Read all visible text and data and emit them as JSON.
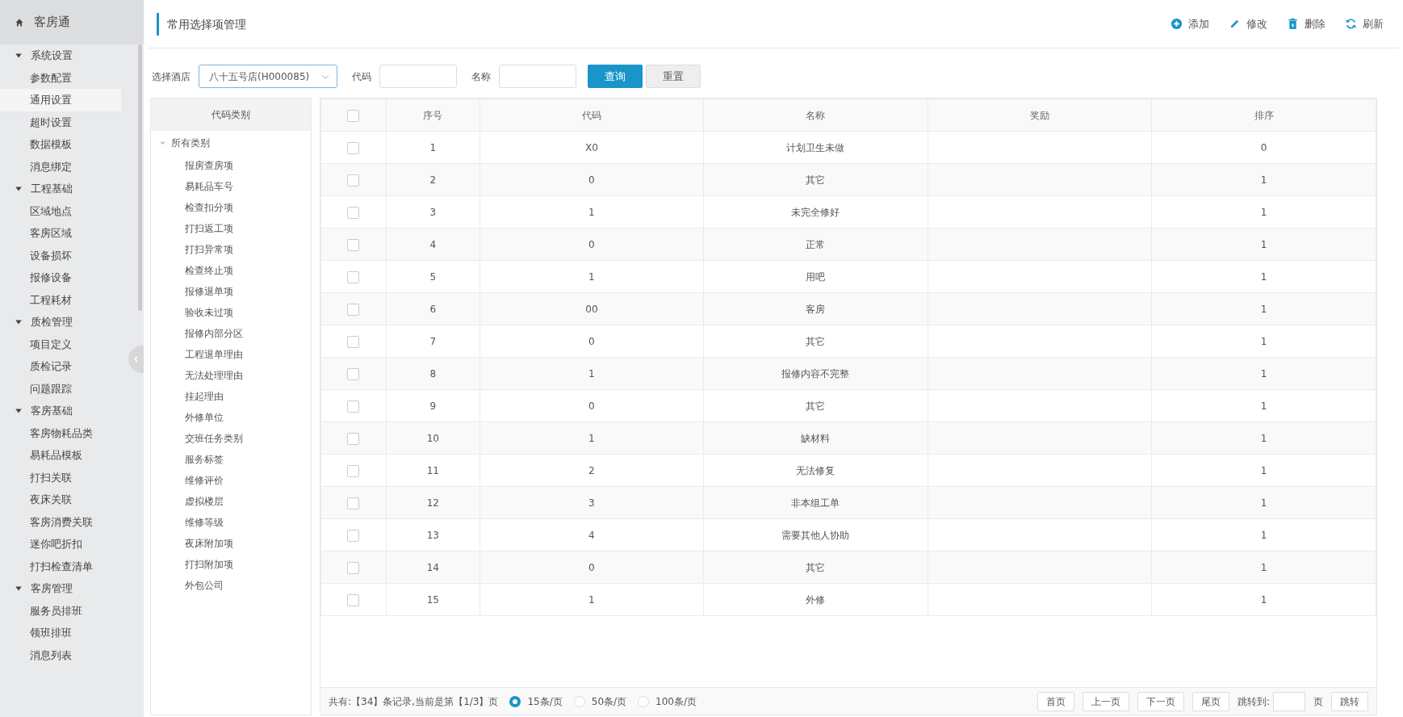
{
  "app": {
    "title": "客房通"
  },
  "sidebar": {
    "groups": [
      {
        "label": "系统设置",
        "expanded": true,
        "items": [
          {
            "label": "参数配置",
            "selected": false
          },
          {
            "label": "通用设置",
            "selected": true
          },
          {
            "label": "超时设置",
            "selected": false
          },
          {
            "label": "数据模板",
            "selected": false
          },
          {
            "label": "消息绑定",
            "selected": false
          }
        ]
      },
      {
        "label": "工程基础",
        "expanded": true,
        "items": [
          {
            "label": "区域地点",
            "selected": false
          },
          {
            "label": "客房区域",
            "selected": false
          },
          {
            "label": "设备损坏",
            "selected": false
          },
          {
            "label": "报修设备",
            "selected": false
          },
          {
            "label": "工程耗材",
            "selected": false
          }
        ]
      },
      {
        "label": "质检管理",
        "expanded": true,
        "items": [
          {
            "label": "项目定义",
            "selected": false
          },
          {
            "label": "质检记录",
            "selected": false
          },
          {
            "label": "问题跟踪",
            "selected": false
          }
        ]
      },
      {
        "label": "客房基础",
        "expanded": true,
        "items": [
          {
            "label": "客房物耗品类",
            "selected": false
          },
          {
            "label": "易耗品模板",
            "selected": false
          },
          {
            "label": "打扫关联",
            "selected": false
          },
          {
            "label": "夜床关联",
            "selected": false
          },
          {
            "label": "客房消费关联",
            "selected": false
          },
          {
            "label": "迷你吧折扣",
            "selected": false
          },
          {
            "label": "打扫检查清单",
            "selected": false
          }
        ]
      },
      {
        "label": "客房管理",
        "expanded": true,
        "items": [
          {
            "label": "服务员排班",
            "selected": false
          },
          {
            "label": "领班排班",
            "selected": false
          },
          {
            "label": "消息列表",
            "selected": false
          }
        ]
      }
    ]
  },
  "page": {
    "title": "常用选择项管理"
  },
  "toolbar": [
    {
      "kind": "add",
      "label": "添加"
    },
    {
      "kind": "edit",
      "label": "修改"
    },
    {
      "kind": "delete",
      "label": "删除"
    },
    {
      "kind": "refresh",
      "label": "刷新"
    }
  ],
  "filters": {
    "hotel_label": "选择酒店",
    "hotel_value": "八十五号店(H000085)",
    "code_label": "代码",
    "name_label": "名称",
    "search_button": "查询",
    "reset_button": "重置"
  },
  "category_tree": {
    "title": "代码类别",
    "root": {
      "label": "所有类别",
      "expanded": true,
      "children": [
        {
          "label": "报房查房项"
        },
        {
          "label": "易耗品车号"
        },
        {
          "label": "检查扣分项"
        },
        {
          "label": "打扫返工项"
        },
        {
          "label": "打扫异常项"
        },
        {
          "label": "检查终止项"
        },
        {
          "label": "报修退单项"
        },
        {
          "label": "验收未过项"
        },
        {
          "label": "报修内部分区"
        },
        {
          "label": "工程退单理由"
        },
        {
          "label": "无法处理理由"
        },
        {
          "label": "挂起理由"
        },
        {
          "label": "外修单位"
        },
        {
          "label": "交班任务类别"
        },
        {
          "label": "服务标签"
        },
        {
          "label": "维修评价"
        },
        {
          "label": "虚拟楼层"
        },
        {
          "label": "维修等级"
        },
        {
          "label": "夜床附加项"
        },
        {
          "label": "打扫附加项"
        },
        {
          "label": "外包公司"
        }
      ]
    }
  },
  "table": {
    "columns": [
      "序号",
      "代码",
      "名称",
      "奖励",
      "排序"
    ],
    "all_checked": false,
    "rows": [
      {
        "checked": false,
        "no": "1",
        "code": "X0",
        "name": "计划卫生未做",
        "sort": "0"
      },
      {
        "checked": false,
        "no": "2",
        "code": "0",
        "name": "其它",
        "sort": "1"
      },
      {
        "checked": false,
        "no": "3",
        "code": "1",
        "name": "未完全修好",
        "sort": "1"
      },
      {
        "checked": false,
        "no": "4",
        "code": "0",
        "name": "正常",
        "sort": "1"
      },
      {
        "checked": false,
        "no": "5",
        "code": "1",
        "name": "用吧",
        "sort": "1"
      },
      {
        "checked": false,
        "no": "6",
        "code": "00",
        "name": "客房",
        "sort": "1"
      },
      {
        "checked": false,
        "no": "7",
        "code": "0",
        "name": "其它",
        "sort": "1"
      },
      {
        "checked": false,
        "no": "8",
        "code": "1",
        "name": "报修内容不完整",
        "sort": "1"
      },
      {
        "checked": false,
        "no": "9",
        "code": "0",
        "name": "其它",
        "sort": "1"
      },
      {
        "checked": false,
        "no": "10",
        "code": "1",
        "name": "缺材料",
        "sort": "1"
      },
      {
        "checked": false,
        "no": "11",
        "code": "2",
        "name": "无法修复",
        "sort": "1"
      },
      {
        "checked": false,
        "no": "12",
        "code": "3",
        "name": "非本组工单",
        "sort": "1"
      },
      {
        "checked": false,
        "no": "13",
        "code": "4",
        "name": "需要其他人协助",
        "sort": "1"
      },
      {
        "checked": false,
        "no": "14",
        "code": "0",
        "name": "其它",
        "sort": "1"
      },
      {
        "checked": false,
        "no": "15",
        "code": "1",
        "name": "外修",
        "sort": "1"
      }
    ]
  },
  "pagination": {
    "summary": "共有:【34】条记录,当前是第【1/3】页",
    "page_sizes": [
      {
        "label": "15条/页",
        "selected": true
      },
      {
        "label": "50条/页",
        "selected": false
      },
      {
        "label": "100条/页",
        "selected": false
      }
    ],
    "buttons": [
      "首页",
      "上一页",
      "下一页",
      "尾页"
    ],
    "jump_label": "跳转到:",
    "page_unit": "页",
    "jump_button": "跳转"
  }
}
